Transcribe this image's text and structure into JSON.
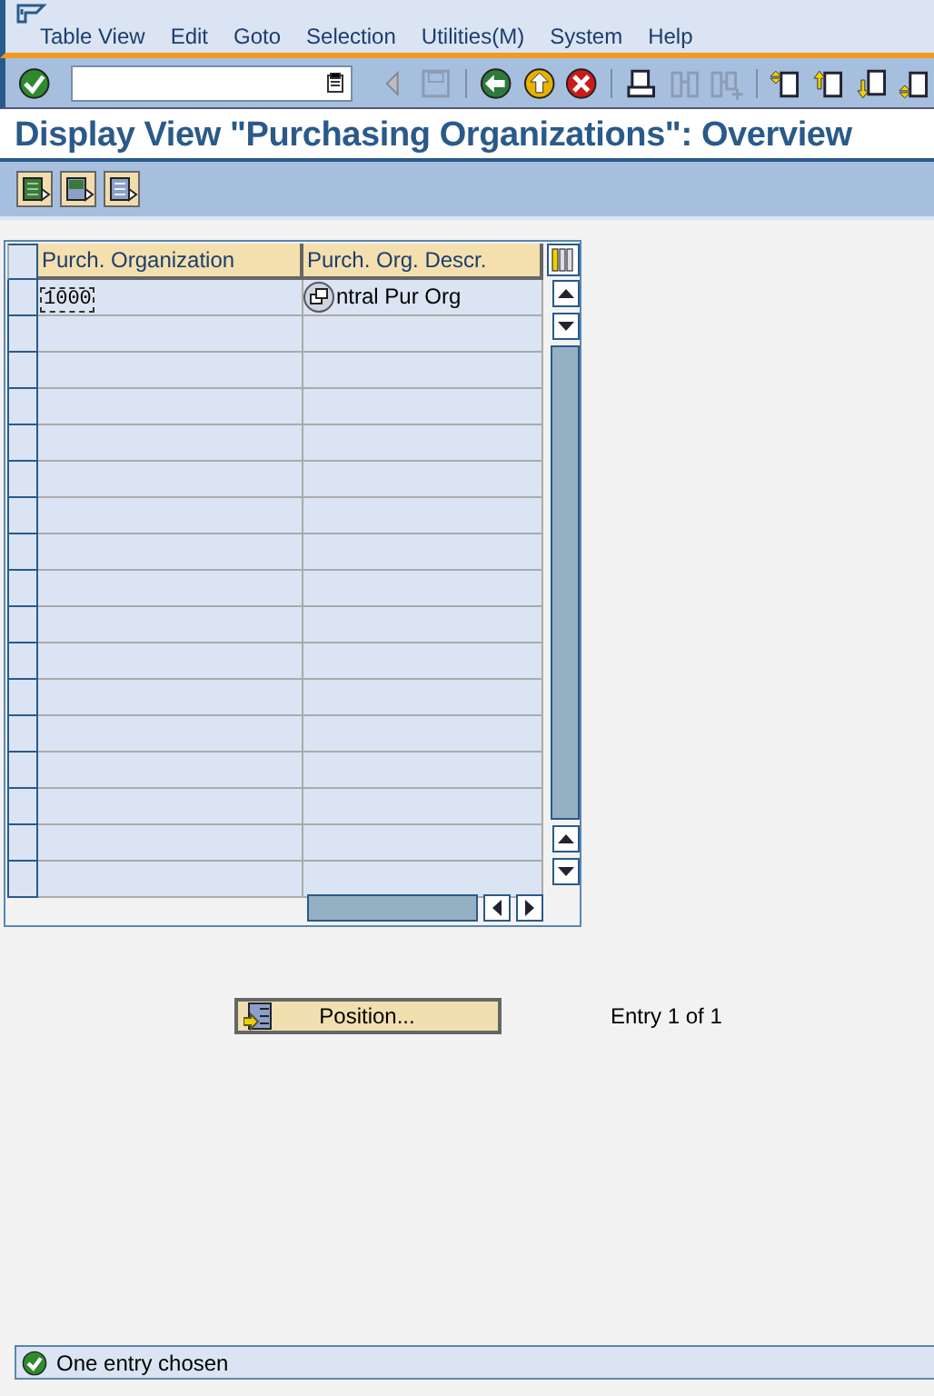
{
  "menu": [
    "Table View",
    "Edit",
    "Goto",
    "Selection",
    "Utilities(M)",
    "System",
    "Help"
  ],
  "toolbar": [
    {
      "kind": "enter",
      "disabled": false
    },
    {
      "kind": "command"
    },
    {
      "kind": "back-arrow",
      "disabled": true
    },
    {
      "kind": "save",
      "disabled": true
    },
    {
      "kind": "back",
      "disabled": false
    },
    {
      "kind": "exit",
      "disabled": false
    },
    {
      "kind": "cancel",
      "disabled": false
    },
    {
      "kind": "print",
      "disabled": false
    },
    {
      "kind": "find",
      "disabled": true
    },
    {
      "kind": "find-next",
      "disabled": true
    },
    {
      "kind": "first-page"
    },
    {
      "kind": "prev-page"
    },
    {
      "kind": "next-page"
    },
    {
      "kind": "last-page"
    }
  ],
  "title": "Display View \"Purchasing Organizations\": Overview",
  "app_toolbar": [
    {
      "kind": "select-all"
    },
    {
      "kind": "select-block"
    },
    {
      "kind": "deselect-all"
    }
  ],
  "table": {
    "columns": [
      "Purch. Organization",
      "Purch. Org. Descr."
    ],
    "rows": [
      {
        "cells": [
          "1000",
          "ntral Pur Org"
        ]
      }
    ]
  },
  "position_button": "Position...",
  "entry_info": "Entry 1 of 1",
  "status_bar": {
    "message": "One entry chosen"
  }
}
